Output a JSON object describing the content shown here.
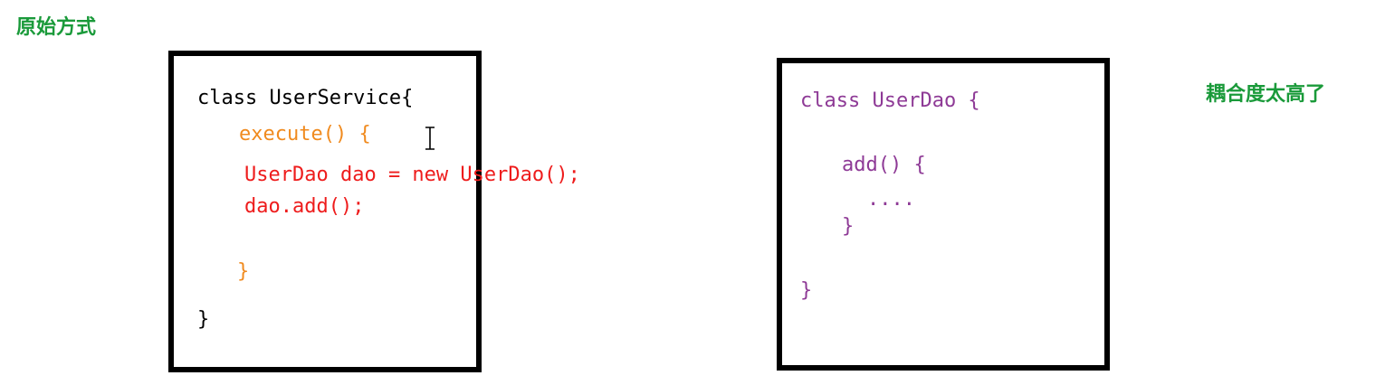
{
  "colors": {
    "label": "#1a9a3a",
    "border": "#000000",
    "service_class": "#000000",
    "service_method": "#f08a1e",
    "service_body": "#ee1c1c",
    "dao": "#8e3a96"
  },
  "labels": {
    "original_way": "原始方式",
    "coupling_too_high": "耦合度太高了"
  },
  "user_service": {
    "class_decl": "class UserService{",
    "method_decl": "execute() {",
    "body_line1": "UserDao dao = new UserDao();",
    "body_line2": "dao.add();",
    "method_close": "}",
    "class_close": "}"
  },
  "user_dao": {
    "class_decl": "class UserDao {",
    "method_decl": "add() {",
    "body": "....",
    "method_close": "}",
    "class_close": "}"
  },
  "icons": {
    "text_cursor": "text-cursor-icon"
  }
}
